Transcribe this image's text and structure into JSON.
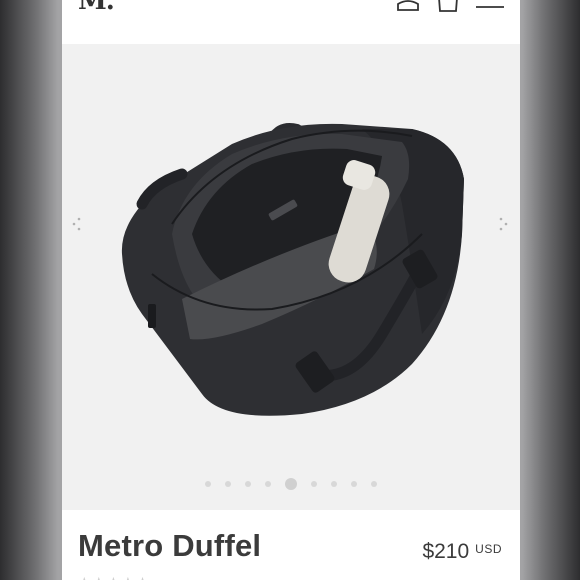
{
  "header": {
    "logo": "M.",
    "icons": [
      "account-icon",
      "cart-icon",
      "menu-icon"
    ]
  },
  "gallery": {
    "image": "black duffel bag, open, top view",
    "dot_count": 9,
    "active_dot": 4
  },
  "product": {
    "name": "Metro Duffel",
    "price": "$210",
    "currency": "USD",
    "stars": "★★★★★"
  },
  "colors": {
    "text": "#3b3b3b",
    "gallery_bg": "#f1f1f1",
    "bag": "#2e2f33"
  }
}
